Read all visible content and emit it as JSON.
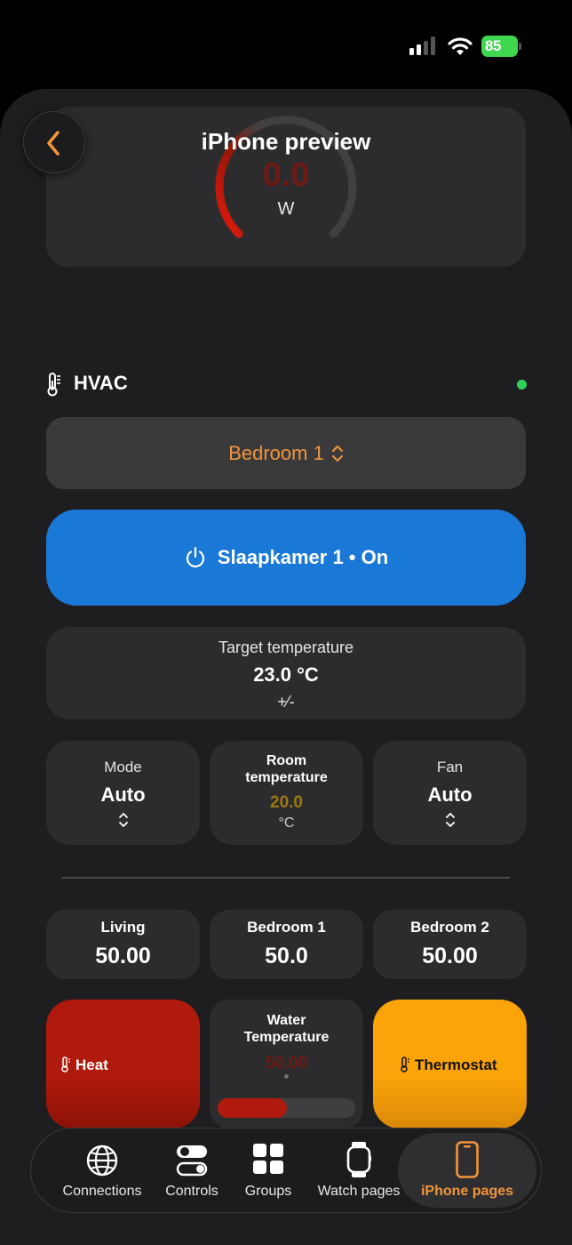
{
  "status_bar": {
    "battery_level": "85",
    "signal_bars": 2,
    "signal_bars_total": 4
  },
  "header": {
    "title": "iPhone preview",
    "back_icon": "chevron-left-icon"
  },
  "power_gauge": {
    "value": "0.0",
    "unit": "W",
    "level": 0.0
  },
  "hvac": {
    "title": "HVAC",
    "icon": "thermometer-icon",
    "connected": true,
    "room_picker": {
      "selected": "Bedroom 1"
    },
    "power_button": {
      "label": "Slaapkamer 1 • On",
      "icon": "power-icon"
    },
    "target": {
      "label": "Target temperature",
      "value": "23.0 °C",
      "adjust": "+⁄-"
    },
    "mode": {
      "label": "Mode",
      "value": "Auto"
    },
    "room_temperature": {
      "label_line1": "Room",
      "label_line2": "temperature",
      "value": "20.0",
      "unit": "°C"
    },
    "fan": {
      "label": "Fan",
      "value": "Auto"
    }
  },
  "sensors": [
    {
      "label": "Living",
      "value": "50.00"
    },
    {
      "label": "Bedroom 1",
      "value": "50.0"
    },
    {
      "label": "Bedroom 2",
      "value": "50.00"
    }
  ],
  "heat_tile": {
    "label": "Heat",
    "color": "#b01a0c"
  },
  "water_tile": {
    "label_line1": "Water",
    "label_line2": "Temperature",
    "value": "50.00",
    "unit": "°",
    "fill": 0.5
  },
  "thermostat_tile": {
    "label": "Thermostat",
    "color": "#fba40a"
  },
  "tab_bar": {
    "tabs": [
      {
        "label": "Connections",
        "icon": "globe-icon"
      },
      {
        "label": "Controls",
        "icon": "toggles-icon"
      },
      {
        "label": "Groups",
        "icon": "grid-icon"
      },
      {
        "label": "Watch pages",
        "icon": "watch-icon"
      },
      {
        "label": "iPhone pages",
        "icon": "iphone-icon",
        "active": true
      }
    ]
  },
  "colors": {
    "accent": "#f3953a",
    "primary_blue": "#1a78d6",
    "heat_red": "#b01a0c",
    "status_green": "#30d158"
  }
}
